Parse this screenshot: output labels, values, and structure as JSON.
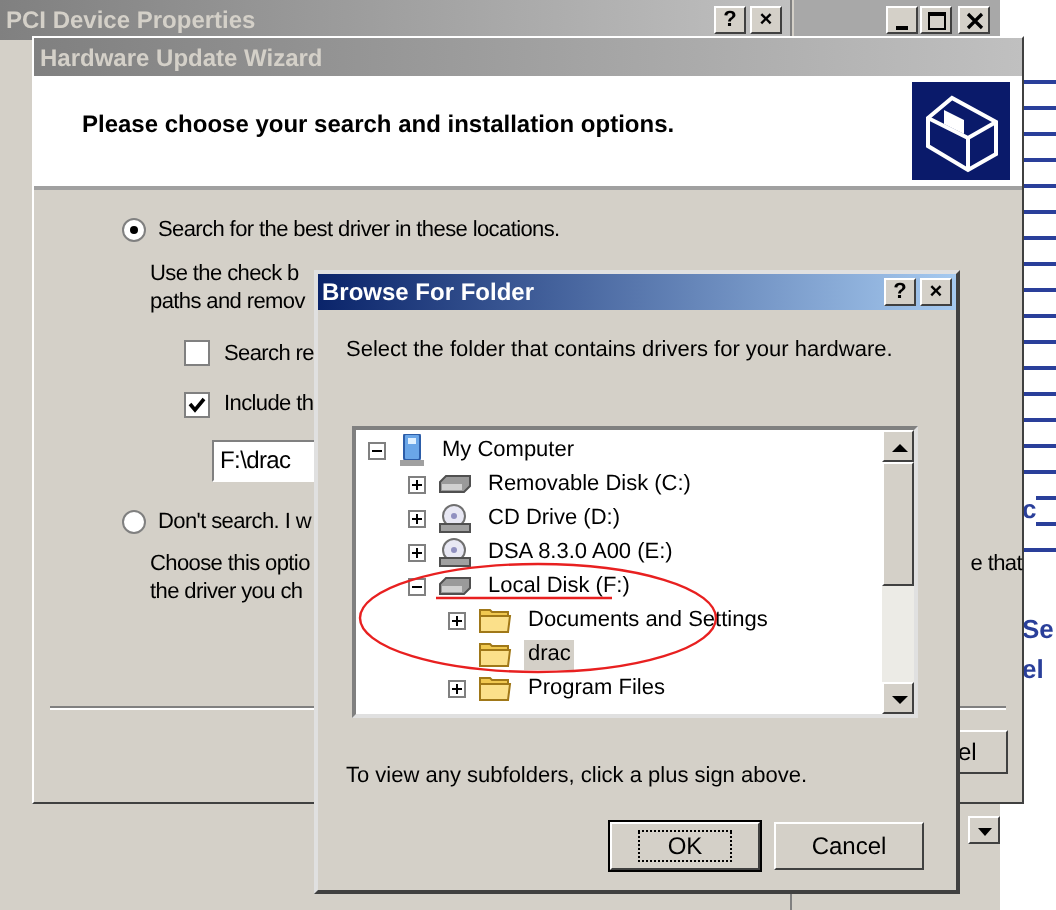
{
  "properties_window": {
    "title": "PCI Device Properties",
    "title_buttons": [
      "?",
      "×"
    ]
  },
  "side_page": {
    "fragments": [
      "c",
      "Se",
      "el"
    ]
  },
  "wizard": {
    "title": "Hardware Update Wizard",
    "heading": "Please choose your search and installation options.",
    "options": [
      {
        "label": "Search for the best driver in these locations.",
        "selected": true,
        "description": [
          "Use the check b",
          "paths and remov"
        ]
      },
      {
        "label": "Don't search. I w",
        "selected": false,
        "description": [
          "Choose this optio",
          "the driver you ch"
        ],
        "description_tail": "e that"
      }
    ],
    "checkboxes": [
      {
        "label": "Search re",
        "checked": false
      },
      {
        "label": "Include th",
        "checked": true
      }
    ],
    "path": {
      "value": "F:\\drac"
    },
    "buttons": [
      "el"
    ]
  },
  "browse_dialog": {
    "title": "Browse For Folder",
    "title_buttons": [
      "?",
      "×"
    ],
    "instruction": "Select the folder that contains drivers for your hardware.",
    "tree": [
      {
        "label": "My Computer",
        "kind": "computer",
        "expanded": true,
        "selected": false,
        "children": [
          {
            "label": "Removable Disk (C:)",
            "kind": "drive",
            "expanded": false,
            "selected": false
          },
          {
            "label": "CD Drive (D:)",
            "kind": "cd",
            "expanded": false,
            "selected": false
          },
          {
            "label": "DSA 8.3.0 A00 (E:)",
            "kind": "cd",
            "expanded": false,
            "selected": false
          },
          {
            "label": "Local Disk (F:)",
            "kind": "drive",
            "expanded": true,
            "selected": false,
            "children": [
              {
                "label": "Documents and Settings",
                "kind": "folder",
                "expanded": false,
                "selected": false
              },
              {
                "label": "drac",
                "kind": "folder",
                "selected": true
              },
              {
                "label": "Program Files",
                "kind": "folder",
                "expanded": false,
                "selected": false
              }
            ]
          }
        ]
      }
    ],
    "hint": "To view any subfolders, click a plus sign above.",
    "buttons": [
      {
        "label": "OK",
        "default": true
      },
      {
        "label": "Cancel",
        "default": false
      }
    ]
  }
}
